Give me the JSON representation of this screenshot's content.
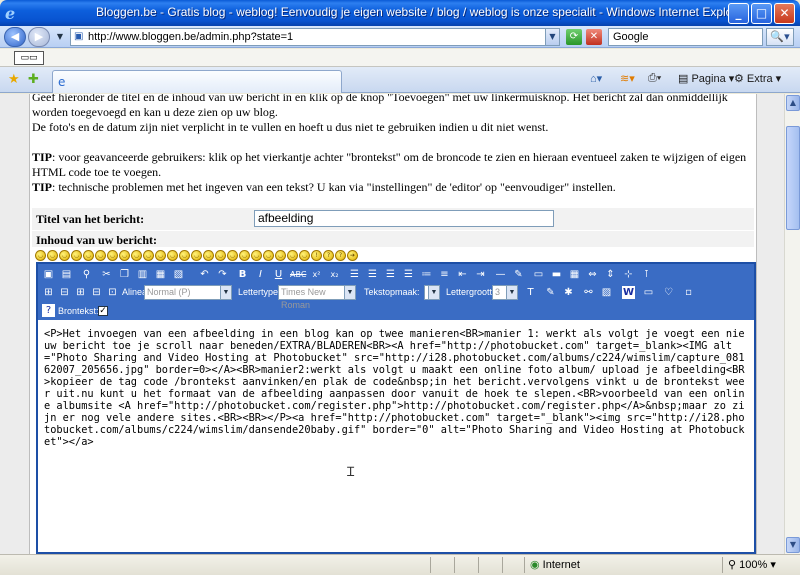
{
  "window": {
    "title": "Bloggen.be - Gratis blog - weblog! Eenvoudig je eigen website / blog / weblog is onze specialit - Windows Internet Explorer",
    "minimize": "_",
    "maximize": "□",
    "close": "✕"
  },
  "address": {
    "url": "http://www.bloggen.be/admin.php?state=1",
    "search_value": "Google"
  },
  "toolbar": {
    "pagina_label": "Pagina",
    "extra_label": "Extra"
  },
  "page": {
    "intro_line1": "Geef hieronder de titel en de inhoud van uw bericht in en klik op de knop \"Toevoegen\" met uw linkermuisknop. Het bericht zal dan onmiddellijk worden toegevoegd en kan u deze zien op uw blog.",
    "intro_line2": "De foto's en de datum zijn niet verplicht in te vullen en hoeft u dus niet te gebruiken indien u dit niet wenst.",
    "tip_label": "TIP",
    "tip1": ": voor geavanceerde gebruikers: klik op het vierkantje achter \"brontekst\" om de broncode te zien en hieraan eventueel zaken te wijzigen of eigen HTML code toe te voegen.",
    "tip2": ": technische problemen met het ingeven van een tekst? U kan via \"instellingen\" de 'editor' op \"eenvoudiger\" instellen.",
    "title_label": "Titel van het bericht:",
    "title_value": "afbeelding",
    "content_label": "Inhoud van uw bericht:"
  },
  "editor": {
    "alinea_label": "Alinea:",
    "alinea_value": "Normal (P)",
    "lettertype_label": "Lettertype:",
    "lettertype_value": "Times New Roman",
    "tekstopmaak_label": "Tekstopmaak:",
    "lettergrootte_label": "Lettergrootte:",
    "lettergrootte_value": "3",
    "brontekst_label": "Brontekst:",
    "brontekst_checked": "✓",
    "code_text": "<P>Het invoegen van een afbeelding in een blog kan op twee manieren<BR>manier 1: werkt als volgt je voegt een nieuw bericht toe je scroll naar beneden/EXTRA/BLADEREN<BR><A href=\"http://photobucket.com\" target=_blank><IMG alt=\"Photo Sharing and Video Hosting at Photobucket\" src=\"http://i28.photobucket.com/albums/c224/wimslim/capture_08162007_205656.jpg\" border=0></A><BR>manier2:werkt als volgt u maakt een online foto album/ upload je afbeelding<BR>kopieer de tag code /brontekst aanvinken/en plak de code&nbsp;in het bericht.vervolgens vinkt u de brontekst weer uit.nu kunt u het formaat van de afbeelding aanpassen door vanuit de hoek te slepen.<BR>voorbeeld van een online albumsite <A href=\"http://photobucket.com/register.php\">http://photobucket.com/register.php</A>&nbsp;maar zo zijn er nog vele andere sites.<BR><BR></P><a href=\"http://photobucket.com\" target=\"_blank\"><img src=\"http://i28.photobucket.com/albums/c224/wimslim/dansende20baby.gif\" border=\"0\" alt=\"Photo Sharing and Video Hosting at Photobucket\"></a>"
  },
  "status": {
    "zone": "Internet",
    "zoom": "100%"
  }
}
